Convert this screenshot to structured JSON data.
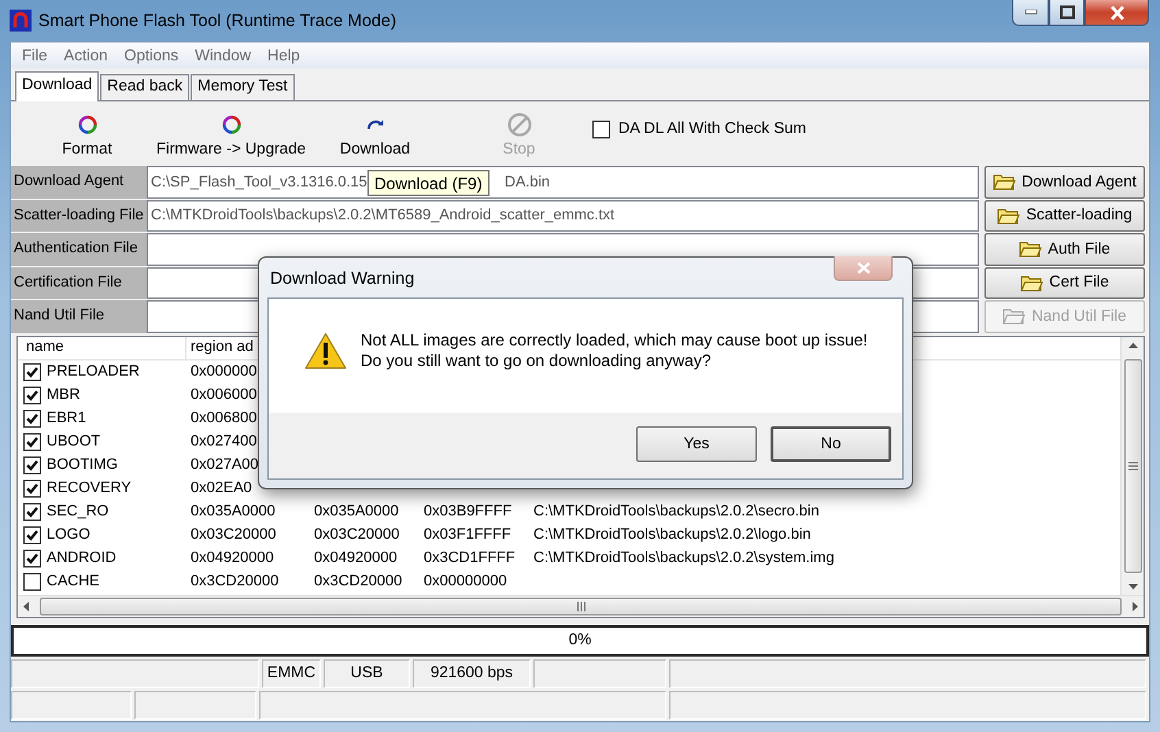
{
  "window": {
    "title": "Smart Phone Flash Tool (Runtime Trace Mode)"
  },
  "menu": [
    "File",
    "Action",
    "Options",
    "Window",
    "Help"
  ],
  "tabs": [
    {
      "label": "Download",
      "selected": true
    },
    {
      "label": "Read back",
      "selected": false
    },
    {
      "label": "Memory Test",
      "selected": false
    }
  ],
  "toolbar": {
    "buttons": [
      {
        "kind": "format",
        "label": "Format",
        "disabled": false
      },
      {
        "kind": "upgrade",
        "label": "Firmware -> Upgrade",
        "disabled": false
      },
      {
        "kind": "download",
        "label": "Download",
        "disabled": false
      },
      {
        "kind": "stop",
        "label": "Stop",
        "disabled": true
      }
    ],
    "check_sum": {
      "label": "DA DL All With Check Sum",
      "checked": false
    }
  },
  "tooltip": "Download (F9)",
  "files": [
    {
      "label": "Download Agent",
      "value": "C:\\SP_Flash_Tool_v3.1316.0.15",
      "value_after": "DA.bin",
      "button": "Download Agent",
      "disabled": false
    },
    {
      "label": "Scatter-loading File",
      "value": "C:\\MTKDroidTools\\backups\\2.0.2\\MT6589_Android_scatter_emmc.txt",
      "button": "Scatter-loading",
      "disabled": false
    },
    {
      "label": "Authentication File",
      "button": "Auth File",
      "disabled": false
    },
    {
      "label": "Certification File",
      "button": "Cert File",
      "disabled": false
    },
    {
      "label": "Nand Util File",
      "button": "Nand Util File",
      "disabled": true
    }
  ],
  "table": {
    "columns": [
      "name",
      "region ad"
    ],
    "rows": [
      {
        "checked": true,
        "cells": [
          "PRELOADER",
          "0x000000"
        ]
      },
      {
        "checked": true,
        "cells": [
          "MBR",
          "0x006000"
        ]
      },
      {
        "checked": true,
        "cells": [
          "EBR1",
          "0x006800"
        ]
      },
      {
        "checked": true,
        "cells": [
          "UBOOT",
          "0x027400"
        ]
      },
      {
        "checked": true,
        "cells": [
          "BOOTIMG",
          "0x027A00"
        ]
      },
      {
        "checked": true,
        "cells": [
          "RECOVERY",
          "0x02EA0"
        ]
      },
      {
        "checked": true,
        "cells": [
          "SEC_RO",
          "0x035A0000",
          "0x035A0000",
          "0x03B9FFFF",
          "C:\\MTKDroidTools\\backups\\2.0.2\\secro.bin"
        ]
      },
      {
        "checked": true,
        "cells": [
          "LOGO",
          "0x03C20000",
          "0x03C20000",
          "0x03F1FFFF",
          "C:\\MTKDroidTools\\backups\\2.0.2\\logo.bin"
        ]
      },
      {
        "checked": true,
        "cells": [
          "ANDROID",
          "0x04920000",
          "0x04920000",
          "0x3CD1FFFF",
          "C:\\MTKDroidTools\\backups\\2.0.2\\system.img"
        ]
      },
      {
        "checked": false,
        "cells": [
          "CACHE",
          "0x3CD20000",
          "0x3CD20000",
          "0x00000000"
        ]
      }
    ]
  },
  "progress": {
    "level": 0,
    "label": "0%"
  },
  "status_bar": [
    "EMMC",
    "USB",
    "921600 bps"
  ],
  "dialog": {
    "title": "Download Warning",
    "message": [
      "Not ALL images are correctly loaded, which may cause boot up issue!",
      "Do you still want to go on downloading anyway?"
    ],
    "buttons": [
      {
        "label": "Yes",
        "focused": false
      },
      {
        "label": "No",
        "focused": true
      }
    ]
  }
}
